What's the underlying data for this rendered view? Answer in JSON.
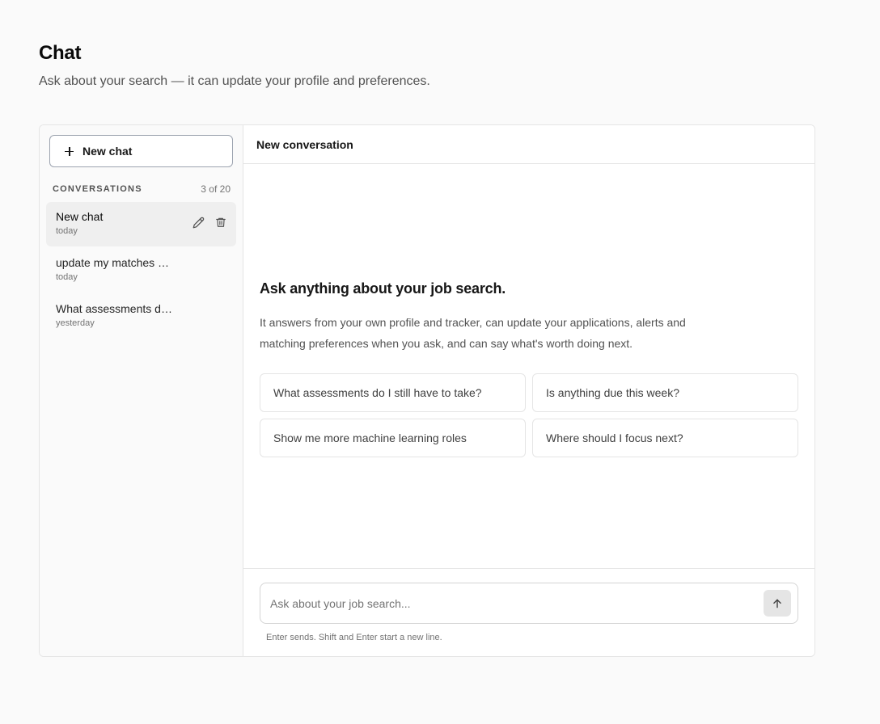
{
  "page": {
    "title": "Chat",
    "subtitle": "Ask about your search — it can update your profile and preferences."
  },
  "sidebar": {
    "new_chat_label": "New chat",
    "conversations_heading": "CONVERSATIONS",
    "conversations_count": "3 of 20",
    "conversations": [
      {
        "title": "New chat",
        "date": "today",
        "active": true
      },
      {
        "title": "update my matches …",
        "date": "today",
        "active": false
      },
      {
        "title": "What assessments d…",
        "date": "yesterday",
        "active": false
      }
    ]
  },
  "main": {
    "header_title": "New conversation",
    "intro_heading": "Ask anything about your job search.",
    "intro_text": "It answers from your own profile and tracker, can update your applications, alerts and matching preferences when you ask, and can say what's worth doing next.",
    "suggestions": [
      "What assessments do I still have to take?",
      "Is anything due this week?",
      "Show me more machine learning roles",
      "Where should I focus next?"
    ]
  },
  "composer": {
    "placeholder": "Ask about your job search...",
    "hint": "Enter sends. Shift and Enter start a new line.",
    "send_icon": "arrow-up-icon"
  },
  "icons": {
    "new_chat": "plus-icon",
    "rename": "pencil-icon",
    "delete": "trash-icon"
  }
}
